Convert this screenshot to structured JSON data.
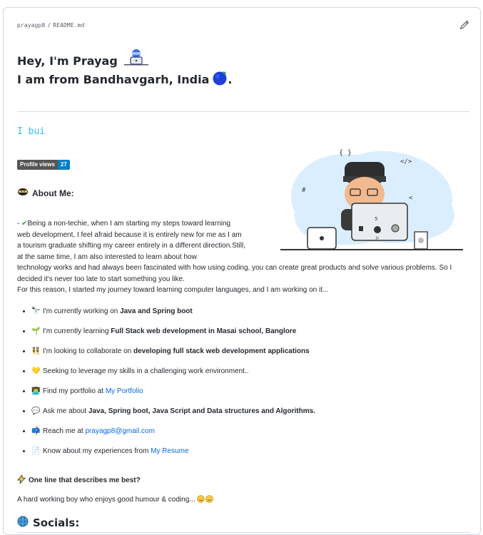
{
  "breadcrumb": {
    "user": "prayagp8",
    "file": "README.md",
    "separator": "/"
  },
  "intro": {
    "line1": "Hey, I'm Prayag",
    "line2": "I am from Bandhavgarh, India",
    "line2_suffix": "."
  },
  "typing_text": "I bui",
  "badge": {
    "label": "Profile views",
    "count": "27"
  },
  "about": {
    "heading": "About Me:",
    "paragraph_start": "- ",
    "paragraph_wrapped": "Being a non-techie, when I am starting my steps toward learning web development, I feel afraid because it is entirely new for me as I am a tourism graduate shifting my career entirely in a different direction.Still, at the same time, I am also interested to learn about how",
    "paragraph_rest": "technology works and had always been fascinated with how using coding, you can create great products and solve various problems. So I decided it's never too late to start something you like.",
    "paragraph_last": "For this reason, I started my journey toward learning computer languages, and I am working on it..."
  },
  "items": [
    {
      "icon": "telescope-icon",
      "glyph": "🔭",
      "prefix": "I'm currently working on ",
      "bold": "Java and Spring boot",
      "link": "",
      "suffix": ""
    },
    {
      "icon": "seedling-icon",
      "glyph": "🌱",
      "prefix": "I'm currently learning ",
      "bold": "Full Stack web development in Masai school, Banglore",
      "link": "",
      "suffix": ""
    },
    {
      "icon": "people-icon",
      "glyph": "👯",
      "prefix": "I'm looking to collaborate on ",
      "bold": "developing full stack web development applications",
      "link": "",
      "suffix": ""
    },
    {
      "icon": "heart-icon",
      "glyph": "💛",
      "prefix": "Seeking to leverage my skills in a challenging work environment..",
      "bold": "",
      "link": "",
      "suffix": ""
    },
    {
      "icon": "portfolio-icon",
      "glyph": "👨‍💻",
      "prefix": "Find my portfolio at ",
      "bold": "",
      "link": "My Portfolio",
      "suffix": ""
    },
    {
      "icon": "speech-bubble-icon",
      "glyph": "💬",
      "prefix": "Ask me about ",
      "bold": "Java, Spring boot, Java Script and Data structures and Algorithms.",
      "link": "",
      "suffix": ""
    },
    {
      "icon": "mailbox-icon",
      "glyph": "📫",
      "prefix": "Reach me at ",
      "bold": "",
      "link": "prayagp8@gmail.com",
      "suffix": ""
    },
    {
      "icon": "document-icon",
      "glyph": "📄",
      "prefix": "Know about my experiences from ",
      "bold": "",
      "link": "My Resume",
      "suffix": ""
    }
  ],
  "one_line": {
    "heading": "One line that describes me best?",
    "text": "A hard working boy who enjoys good humour & coding..."
  },
  "socials": {
    "heading": "Socials:"
  },
  "colors": {
    "accent_link": "#0969da",
    "typing": "#36bcf7",
    "badge_left": "#555555",
    "badge_right": "#007ec6"
  }
}
